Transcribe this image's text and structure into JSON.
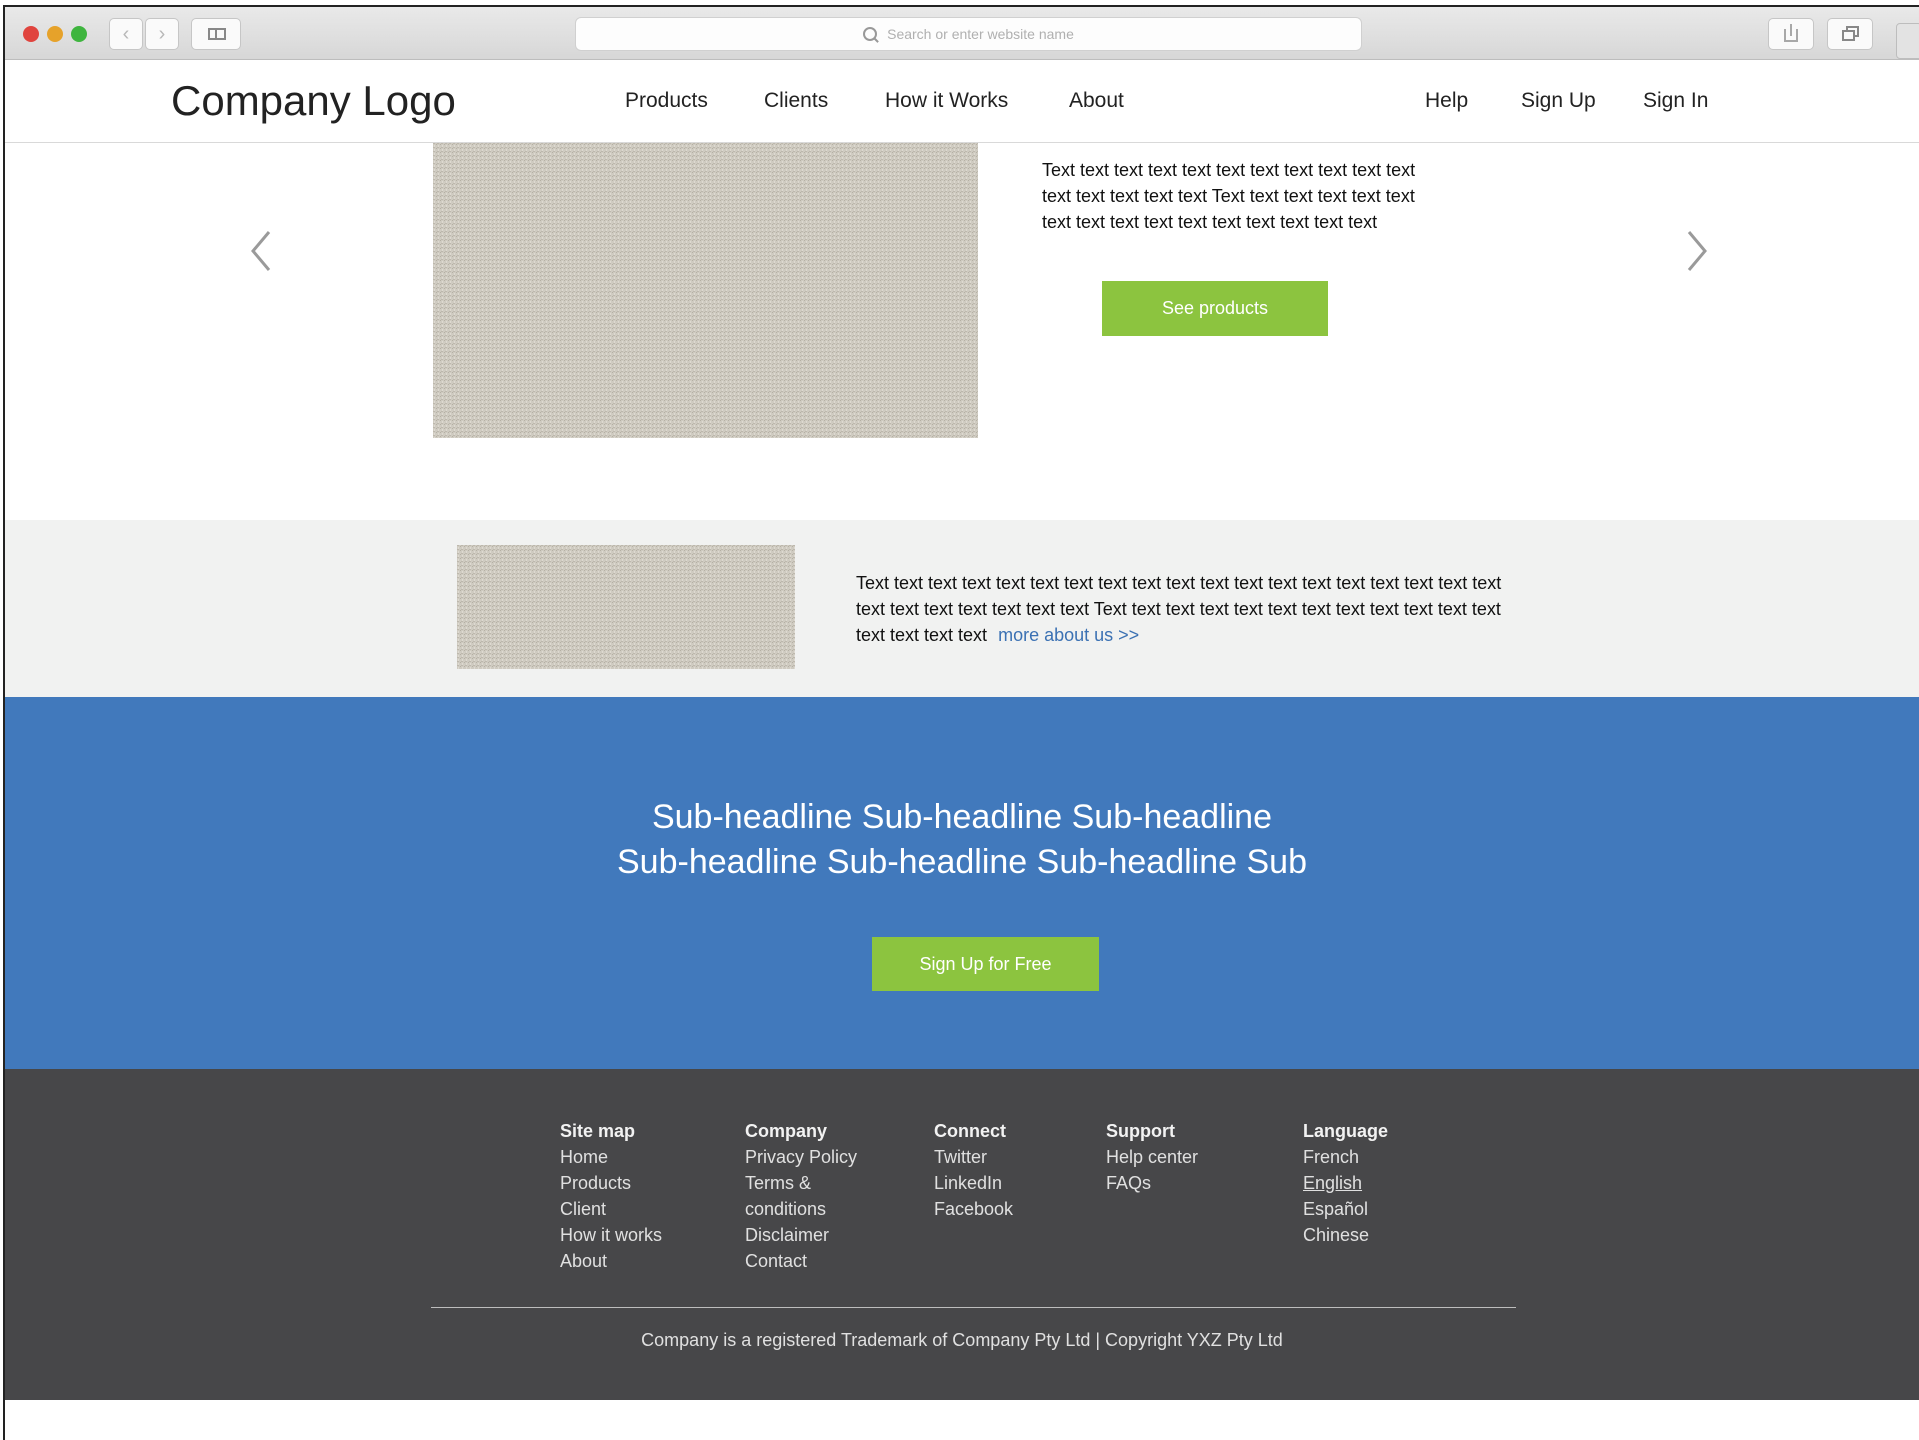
{
  "browser": {
    "url_placeholder": "Search or enter website name",
    "back_glyph": "‹",
    "forward_glyph": "›"
  },
  "header": {
    "logo": "Company Logo",
    "nav": [
      "Products",
      "Clients",
      "How it Works",
      "About"
    ],
    "account": [
      "Help",
      "Sign Up",
      "Sign In"
    ]
  },
  "hero": {
    "text": "Text text text text text text text text text text text text text text text text Text text text text text text text text text text text text text text text text",
    "button": "See products",
    "prev_icon": "chevron-left-icon",
    "next_icon": "chevron-right-icon"
  },
  "about": {
    "text": "Text text text text text text text text text text text text text text text text text text text text text text text text text text Text text text text text text text text text text text text text text text text",
    "link": "more about us >>"
  },
  "cta": {
    "headline_line1": "Sub-headline Sub-headline Sub-headline",
    "headline_line2": "Sub-headline Sub-headline Sub-headline Sub",
    "button": "Sign Up for Free"
  },
  "footer": {
    "columns": [
      {
        "heading": "Site map",
        "items": [
          "Home",
          "Products",
          "Client",
          "How it works",
          "About"
        ]
      },
      {
        "heading": "Company",
        "items": [
          "Privacy Policy",
          "Terms  &",
          "conditions",
          "Disclaimer",
          "Contact"
        ]
      },
      {
        "heading": "Connect",
        "items": [
          "Twitter",
          "LinkedIn",
          "Facebook"
        ]
      },
      {
        "heading": "Support",
        "items": [
          "Help center",
          "FAQs"
        ]
      },
      {
        "heading": "Language",
        "items": [
          "French",
          "English",
          "Español",
          "Chinese"
        ]
      }
    ],
    "copyright": "Company is a registered Trademark of Company Pty Ltd  |  Copyright YXZ Pty Ltd"
  },
  "colors": {
    "accent_green": "#8cc43f",
    "cta_blue": "#4179bc",
    "footer_bg": "#474749",
    "link_blue": "#3b71b3"
  }
}
